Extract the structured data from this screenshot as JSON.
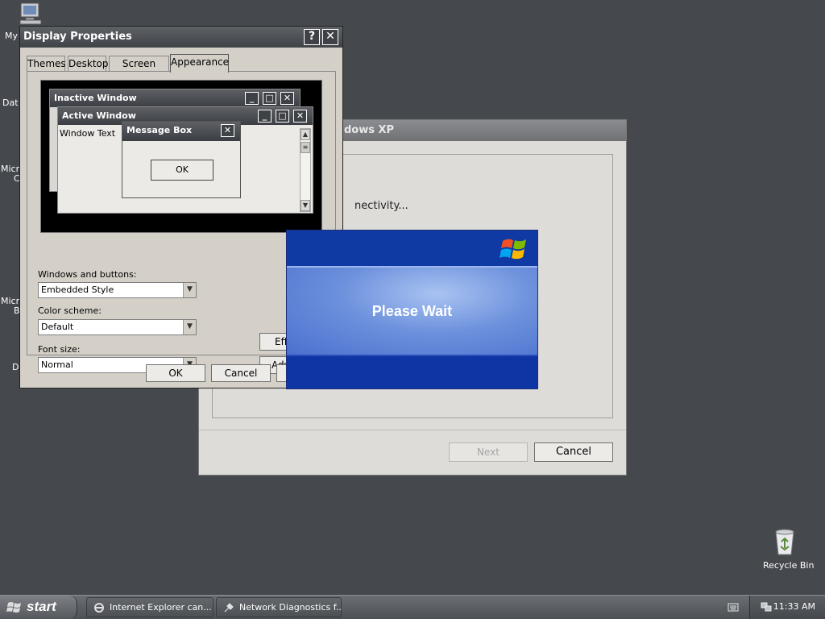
{
  "desktop": {
    "icon_labels": [
      "My",
      "Dat",
      "Micro",
      "C",
      "Micro",
      "B",
      "D"
    ],
    "recycle_bin_label": "Recycle Bin"
  },
  "wizard": {
    "title_fragment": "dows XP",
    "status_fragment": "nectivity...",
    "next_label": "Next",
    "cancel_label": "Cancel"
  },
  "display_properties": {
    "title": "Display Properties",
    "help_glyph": "?",
    "close_glyph": "✕",
    "tabs": [
      {
        "label": "Themes"
      },
      {
        "label": "Desktop"
      },
      {
        "label": "Screen Saver"
      },
      {
        "label": "Appearance"
      }
    ],
    "active_tab": "Appearance",
    "preview": {
      "inactive_title": "Inactive Window",
      "active_title": "Active Window",
      "window_text": "Window Text",
      "message_box_title": "Message Box",
      "ok_label": "OK"
    },
    "windows_and_buttons_label": "Windows and buttons:",
    "windows_and_buttons_value": "Embedded Style",
    "color_scheme_label": "Color scheme:",
    "color_scheme_value": "Default",
    "font_size_label": "Font size:",
    "font_size_value": "Normal",
    "effects_fragment": "Eff",
    "advanced_fragment": "Adv",
    "ok_label": "OK",
    "cancel_label": "Cancel"
  },
  "please_wait": {
    "text": "Please Wait"
  },
  "taskbar": {
    "start_label": "start",
    "tasks": [
      {
        "label": "Internet Explorer can..."
      },
      {
        "label": "Network Diagnostics f..."
      }
    ],
    "clock": "11:33 AM"
  },
  "colors": {
    "desktop": "#45484d",
    "please_wait_blue": "#0f34a3",
    "window_face": "#d4d0c8"
  }
}
